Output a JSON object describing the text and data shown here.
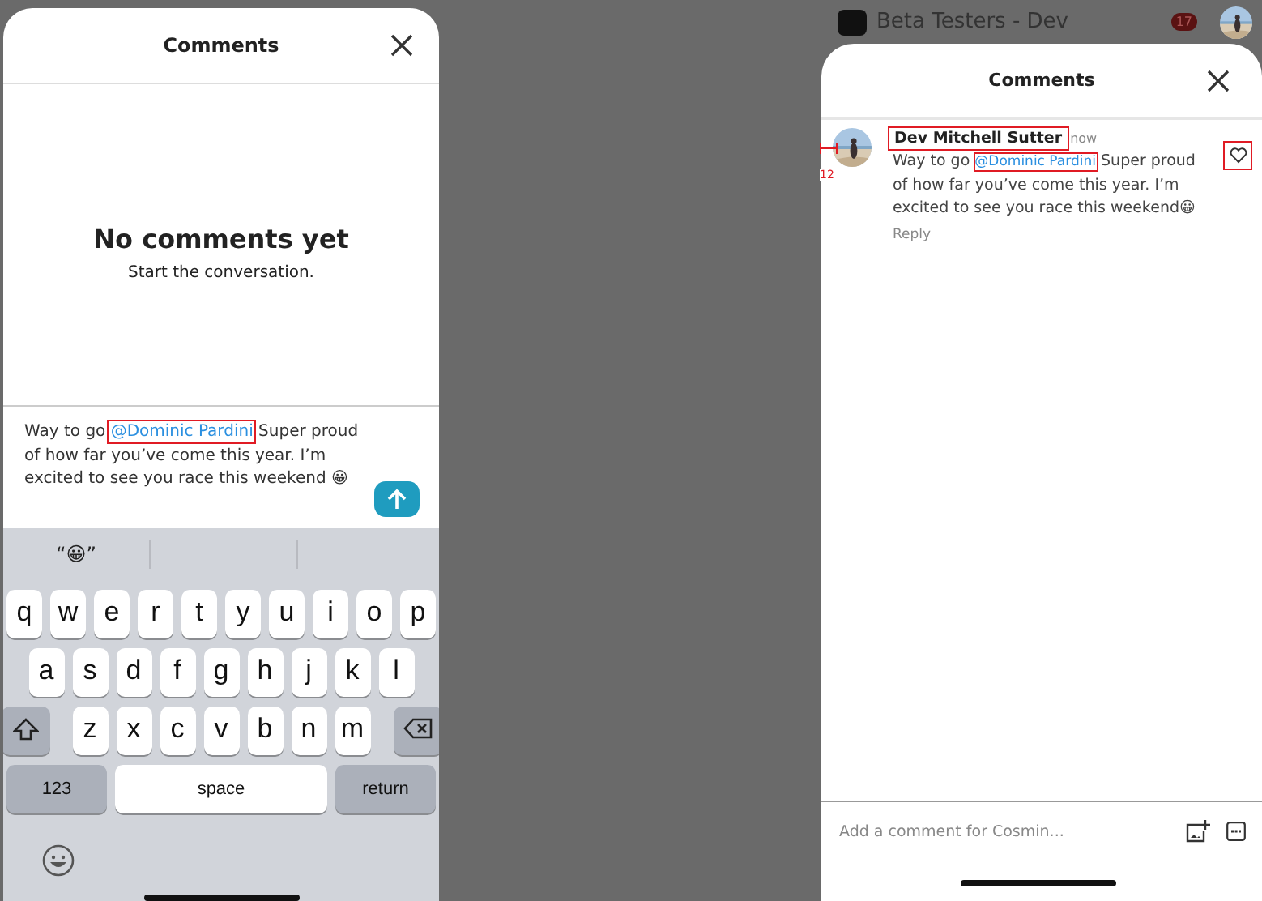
{
  "left_screen": {
    "title": "Comments",
    "empty_title": "No comments yet",
    "empty_subtitle": "Start the conversation.",
    "composer": {
      "parts": [
        {
          "kind": "text",
          "text": "Way to go "
        },
        {
          "kind": "mention",
          "text": "@Dominic Pardini",
          "highlighted": true
        },
        {
          "kind": "text",
          "text": " Super proud of how far you’ve come this year. I’m excited to see you race this weekend 😀"
        }
      ]
    },
    "suggestion": "“😀”",
    "keyboard": {
      "rows": [
        [
          "q",
          "w",
          "e",
          "r",
          "t",
          "y",
          "u",
          "i",
          "o",
          "p"
        ],
        [
          "a",
          "s",
          "d",
          "f",
          "g",
          "h",
          "j",
          "k",
          "l"
        ],
        [
          "z",
          "x",
          "c",
          "v",
          "b",
          "n",
          "m"
        ]
      ],
      "numbers_key": "123",
      "space_key": "space",
      "return_key": "return"
    }
  },
  "right_screen": {
    "background": {
      "title": "Beta Testers - Dev",
      "badge": "17"
    },
    "title": "Comments",
    "comment": {
      "author": "Dev Mitchell Sutter",
      "author_highlighted": true,
      "time": "now",
      "measure": "12",
      "parts": [
        {
          "kind": "text",
          "text": "Way to go "
        },
        {
          "kind": "mention",
          "text": "@Dominic Pardini",
          "highlighted": true
        },
        {
          "kind": "text",
          "text": " Super proud of how far you’ve come this year. I’m excited to see you race this weekend😀"
        }
      ],
      "liked": false,
      "like_highlighted": true,
      "reply": "Reply"
    },
    "composer": {
      "placeholder": "Add a comment for Cosmin..."
    }
  }
}
